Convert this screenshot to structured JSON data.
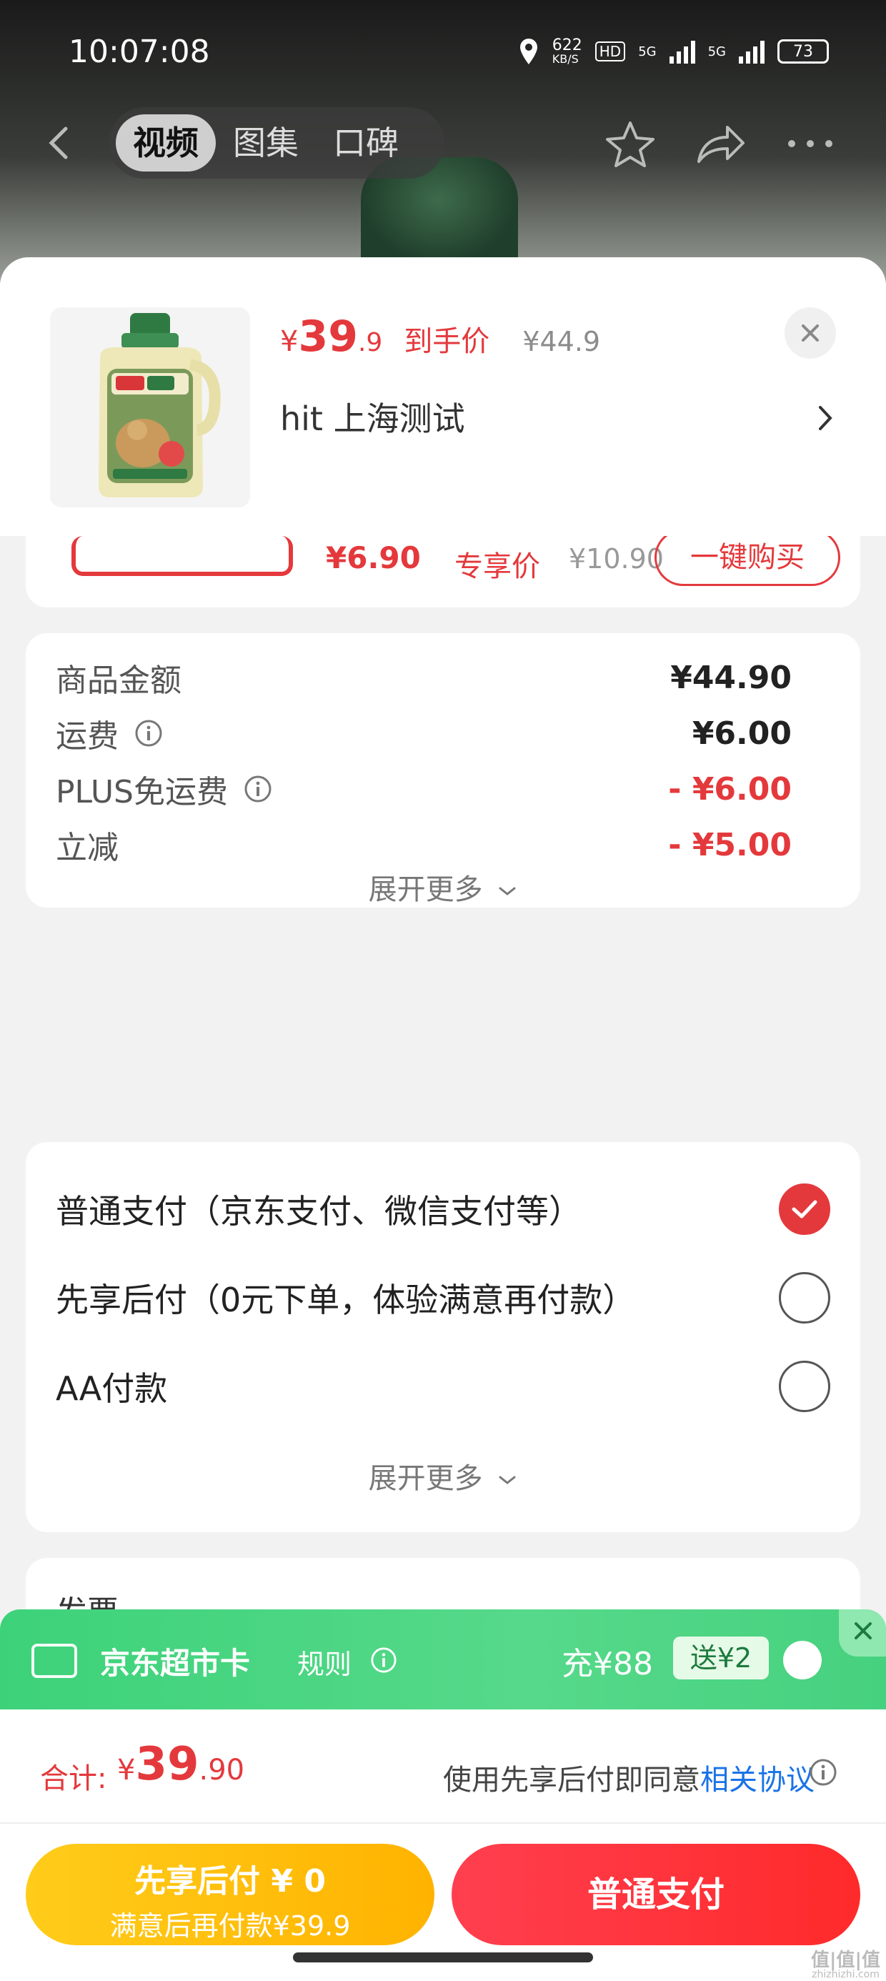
{
  "status_bar": {
    "time": "10:07:08",
    "net_speed": "622",
    "net_unit": "KB/S",
    "hd": "HD",
    "sig1": "5G",
    "sig2": "5G",
    "battery": "73"
  },
  "header": {
    "tabs": [
      "视频",
      "图集",
      "口碑"
    ],
    "active_tab": 0
  },
  "product": {
    "price_symbol": "¥",
    "price_int": "39",
    "price_dec": ".9",
    "price_label": "到手价",
    "original_price": "¥44.9",
    "address": "hit  上海测试"
  },
  "peek": {
    "price": "¥6.90",
    "label": "专享价",
    "orig": "¥10.90",
    "button": "一键购买"
  },
  "cost_breakdown": {
    "rows": [
      {
        "label": "商品金额",
        "value": "¥44.90"
      },
      {
        "label": "运费",
        "value": "¥6.00"
      },
      {
        "label": "PLUS免运费",
        "value": "- ¥6.00"
      },
      {
        "label": "立减",
        "value": "- ¥5.00"
      }
    ],
    "more": "展开更多"
  },
  "payment": {
    "options": [
      {
        "label": "普通支付（京东支付、微信支付等）",
        "checked": true
      },
      {
        "label": "先享后付（0元下单，体验满意再付款）",
        "checked": false
      },
      {
        "label": "AA付款",
        "checked": false
      }
    ],
    "more": "展开更多"
  },
  "coupon_peek": {
    "text": "发票"
  },
  "promo": {
    "title": "京东超市卡",
    "rule": "规则",
    "charge": "充¥88",
    "gift": "送¥2"
  },
  "summary": {
    "label": "合计:",
    "symbol": "¥",
    "int": "39",
    "dec": ".90",
    "agree_prefix": "使用先享后付即同意",
    "agree_link": "相关协议"
  },
  "actions": {
    "later_line1": "先享后付 ¥ 0",
    "later_line2": "满意后再付款¥39.9",
    "pay": "普通支付"
  },
  "watermark": {
    "main": "值|值|值",
    "sub": "zhizhizhi.com"
  },
  "colors": {
    "accent": "#e4393c",
    "green": "#3dd27a",
    "yellow": "#ffb300",
    "link": "#1a73e8"
  }
}
